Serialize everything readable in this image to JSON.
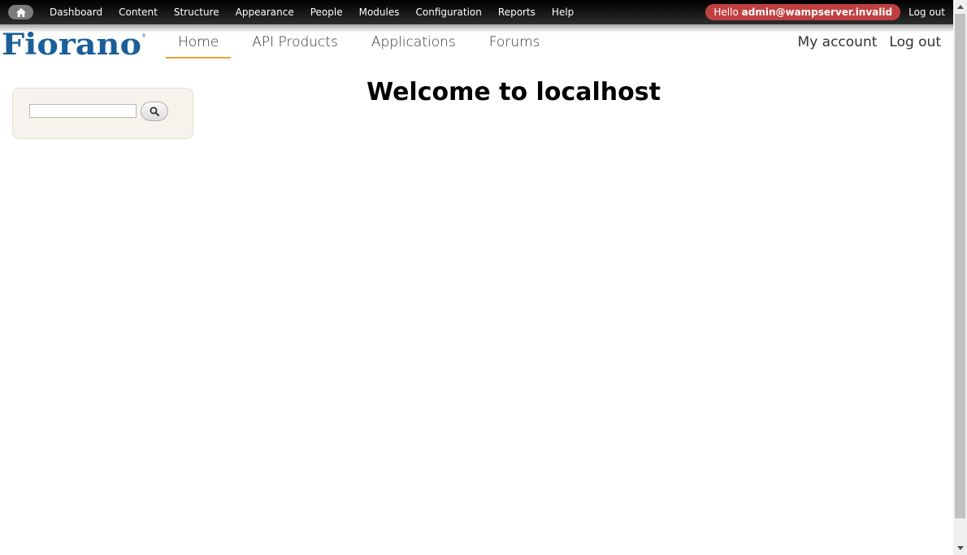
{
  "toolbar": {
    "items": [
      "Dashboard",
      "Content",
      "Structure",
      "Appearance",
      "People",
      "Modules",
      "Configuration",
      "Reports",
      "Help"
    ],
    "hello_prefix": "Hello",
    "user": "admin@wampserver.invalid",
    "logout": "Log out"
  },
  "site": {
    "logo_text": "Fiorano",
    "brand_color": "#1a5e9a"
  },
  "main_nav": {
    "items": [
      "Home",
      "API Products",
      "Applications",
      "Forums"
    ],
    "active": "Home"
  },
  "secondary_nav": {
    "my_account": "My account",
    "logout": "Log out"
  },
  "search": {
    "value": "",
    "button_icon": "search-icon"
  },
  "page": {
    "title": "Welcome to localhost"
  },
  "colors": {
    "accent": "#e8a33a",
    "hello_pill": "#c04040"
  }
}
